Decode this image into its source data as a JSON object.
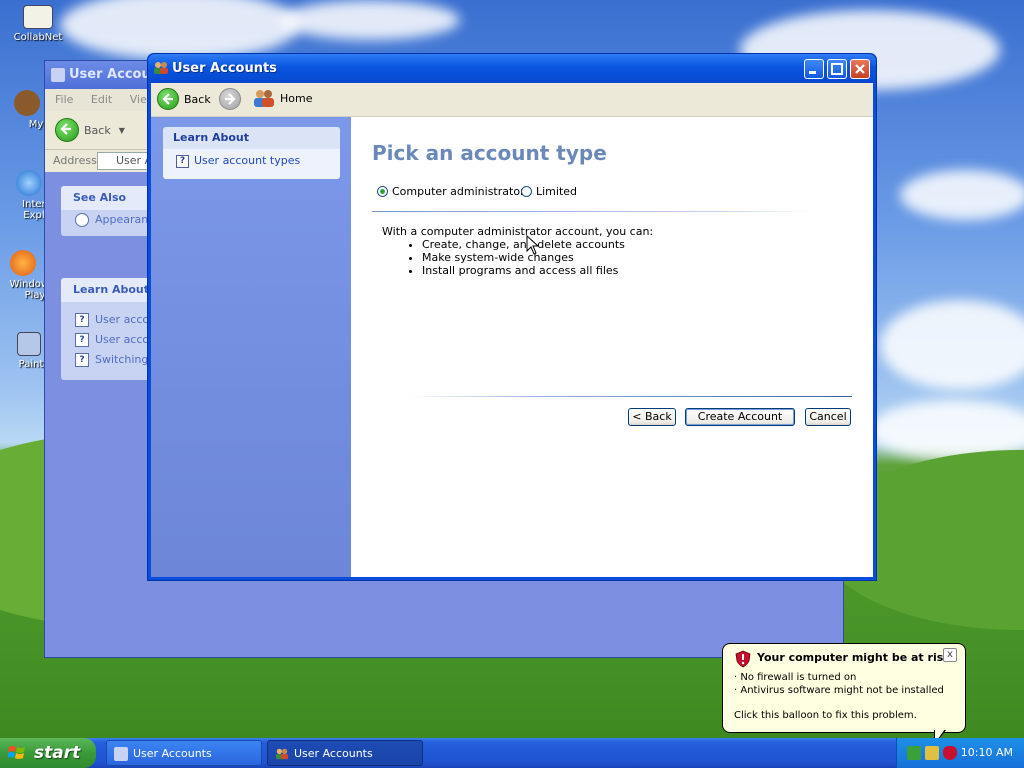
{
  "desktop": {
    "icons": [
      {
        "label": "CollabNet"
      },
      {
        "label": "MyP"
      },
      {
        "label": "Intern"
      },
      {
        "label": "Explo"
      },
      {
        "label": "Windows"
      },
      {
        "label": "Play"
      },
      {
        "label": "Paint"
      }
    ]
  },
  "back_window": {
    "title": "User Accoun",
    "menu": [
      "File",
      "Edit",
      "View"
    ],
    "back_label": "Back",
    "address_label": "Address",
    "address_value": "User A",
    "see_also": {
      "header": "See Also",
      "items": [
        "Appearanc"
      ]
    },
    "learn_about": {
      "header": "Learn About",
      "items": [
        "User accou",
        "User accou",
        "Switching u"
      ]
    }
  },
  "window": {
    "title": "User Accounts",
    "toolbar": {
      "back_label": "Back",
      "home_label": "Home"
    },
    "sidebar": {
      "header": "Learn About",
      "items": [
        {
          "label": "User account types"
        }
      ]
    },
    "content": {
      "heading": "Pick an account type",
      "options": [
        {
          "label": "Computer administrator",
          "selected": true
        },
        {
          "label": "Limited",
          "selected": false
        }
      ],
      "description_intro": "With a computer administrator account, you can:",
      "bullets": [
        "Create, change, and delete accounts",
        "Make system-wide changes",
        "Install programs and access all files"
      ],
      "buttons": {
        "back": "< Back",
        "create": "Create Account",
        "cancel": "Cancel"
      }
    }
  },
  "balloon": {
    "title": "Your computer might be at risk",
    "lines": [
      "· No firewall is turned on",
      "· Antivirus software might not be installed"
    ],
    "action": "Click this balloon to fix this problem.",
    "close": "x"
  },
  "taskbar": {
    "start_label": "start",
    "tasks": [
      {
        "label": "User Accounts"
      },
      {
        "label": "User Accounts"
      }
    ],
    "clock": "10:10 AM"
  },
  "colors": {
    "accent": "#0a4cdc",
    "heading": "#6a89b8",
    "link": "#1f49b7"
  }
}
